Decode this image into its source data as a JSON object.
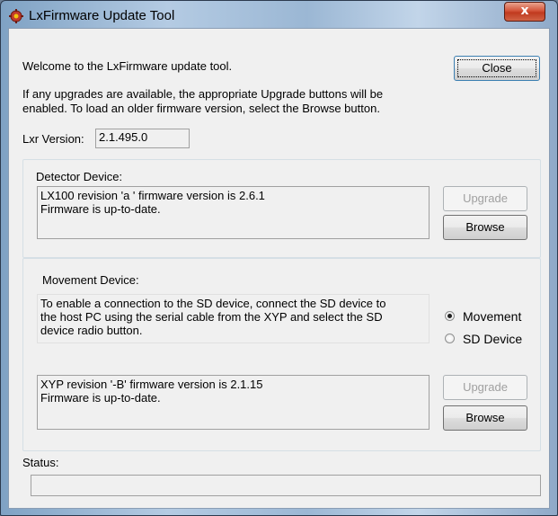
{
  "window": {
    "title": "LxFirmware Update Tool",
    "close_glyph": "x"
  },
  "intro": {
    "welcome": "Welcome to the LxFirmware update tool.",
    "info_line1": "If any upgrades are available, the appropriate Upgrade buttons will be",
    "info_line2": "enabled.  To load an older firmware version, select the Browse button.",
    "close_label": "Close"
  },
  "lxr": {
    "label": "Lxr Version:",
    "value": "2.1.495.0"
  },
  "detector": {
    "label": "Detector Device:",
    "status_line1": "LX100 revision 'a ' firmware version is 2.6.1",
    "status_line2": "Firmware is up-to-date.",
    "upgrade_label": "Upgrade",
    "upgrade_enabled": false,
    "browse_label": "Browse"
  },
  "movement": {
    "label": "Movement Device:",
    "hint_line1": "To enable a connection to the SD device, connect the SD device to",
    "hint_line2": "the host PC using the serial cable from the XYP and select the SD",
    "hint_line3": "device radio button.",
    "radio_movement": "Movement",
    "radio_sd": "SD Device",
    "selected": "Movement",
    "status_line1": "XYP revision '-B' firmware version is 2.1.15",
    "status_line2": "Firmware is up-to-date.",
    "upgrade_label": "Upgrade",
    "upgrade_enabled": false,
    "browse_label": "Browse"
  },
  "status": {
    "label": "Status:",
    "value": ""
  },
  "icons": {
    "app": "firmware-chip-icon",
    "close": "close-icon"
  },
  "colors": {
    "close_button": "#c8442a",
    "client_bg": "#f0f0f0",
    "disabled_text": "#a0a0a0"
  }
}
